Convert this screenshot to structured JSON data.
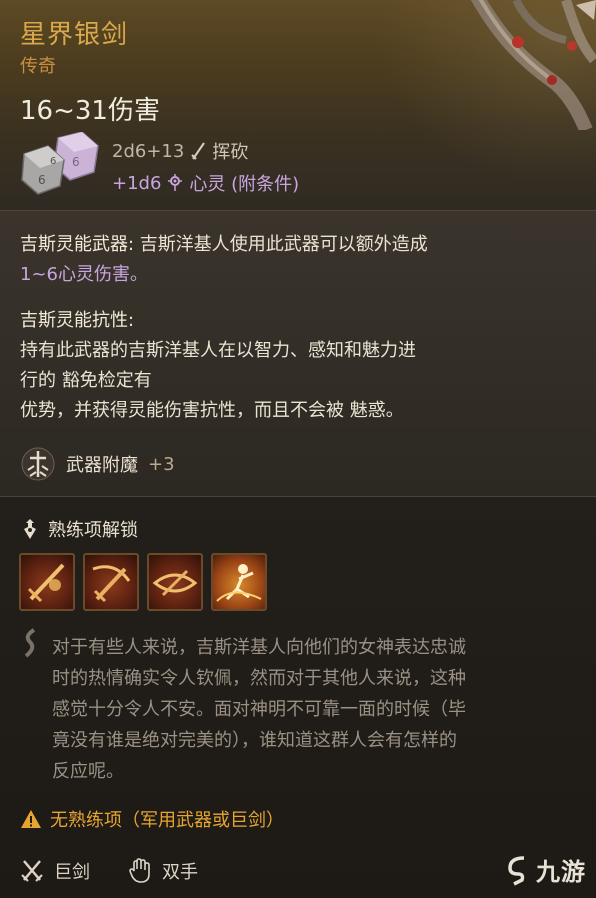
{
  "item": {
    "name": "星界银剑",
    "rarity": "传奇",
    "damage_total": "16~31伤害",
    "damage_dice": "2d6+13",
    "damage_type": "挥砍",
    "bonus_damage": "+1d6",
    "bonus_damage_type": "心灵 (附条件)"
  },
  "properties": {
    "p1_title": "吉斯灵能武器:",
    "p1_text": " 吉斯洋基人使用此武器可以额外造成",
    "p1_text2": "1~6心灵伤害。",
    "p2_title": "吉斯灵能抗性:",
    "p2_line1": "持有此武器的吉斯洋基人在以智力、感知和魅力进",
    "p2_line2": "行的 豁免检定有",
    "p2_line3": "优势，并获得灵能伤害抗性，而且不会被 魅惑。",
    "enchant_label": "武器附魔",
    "enchant_value": "+3"
  },
  "proficiency": {
    "title": "熟练项解锁",
    "skills": [
      "skill-1",
      "skill-2",
      "skill-3",
      "skill-4"
    ]
  },
  "lore": {
    "line1": "对于有些人来说，吉斯洋基人向他们的女神表达忠诚",
    "line2": "时的热情确实令人钦佩，然而对于其他人来说，这种",
    "line3": "感觉十分令人不安。面对神明不可靠一面的时候（毕",
    "line4": "竟没有谁是绝对完美的），谁知道这群人会有怎样的",
    "line5": "反应呢。"
  },
  "warning": "无熟练项（军用武器或巨剑）",
  "footer": {
    "weapon_type": "巨剑",
    "handedness": "双手"
  },
  "watermark": "九游",
  "colors": {
    "item_name": "#d9a84b",
    "rarity": "#c98f3f",
    "psychic": "#c9a5e0",
    "warning": "#e8a431",
    "lore": "#9a9184"
  }
}
